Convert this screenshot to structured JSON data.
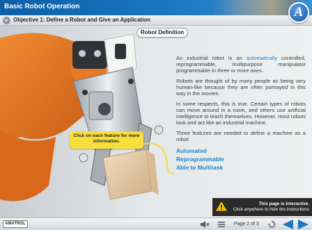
{
  "header": {
    "title": "Basic Robot Operation",
    "logo_letter": "A"
  },
  "objective": {
    "text": "Objective 1: Define a Robot and Give an Application"
  },
  "content": {
    "badge": "Robot Definition",
    "paragraph1_a": "An industrial robot is an ",
    "paragraph1_link": "automatically",
    "paragraph1_b": " controlled, reprogrammable, multipurpose manipulator programmable in three or more axes.",
    "paragraph2": "Robots are thought of by many people as being very human-like because they are often portrayed in this way in the movies.",
    "paragraph3": "In some respects, this is true. Certain types of robots can move around in a room, and others use artificial intelligence to teach themselves. However, most robots look and act like an industrial machine.",
    "paragraph4": "Three features are needed to define a machine as a robot:",
    "features": [
      "Automated",
      "Reprogrammable",
      "Able to Multitask"
    ],
    "callout": {
      "line1": "Click on each feature for more",
      "line2": "information."
    }
  },
  "notice": {
    "line1": "This page is interactive.",
    "line2": "Click anywhere to hide the instructions"
  },
  "footer": {
    "brand": "AMATROL",
    "page_label": "Page 2 of 3"
  },
  "colors": {
    "header": "#1a78c2",
    "link": "#1c86c8",
    "callout": "#f7de3a",
    "robot": "#e8701e"
  }
}
